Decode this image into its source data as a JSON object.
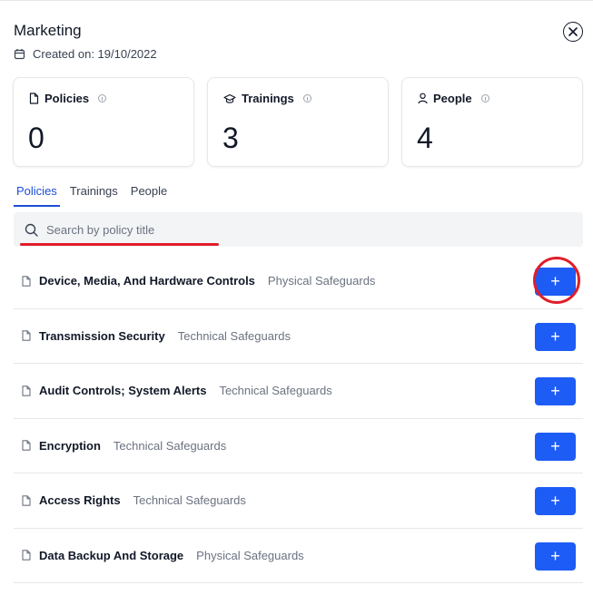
{
  "header": {
    "title": "Marketing",
    "created_label": "Created on: 19/10/2022"
  },
  "stats": [
    {
      "label": "Policies",
      "value": "0",
      "icon": "document-icon"
    },
    {
      "label": "Trainings",
      "value": "3",
      "icon": "graduation-cap-icon"
    },
    {
      "label": "People",
      "value": "4",
      "icon": "person-icon"
    }
  ],
  "tabs": [
    {
      "label": "Policies",
      "active": true
    },
    {
      "label": "Trainings",
      "active": false
    },
    {
      "label": "People",
      "active": false
    }
  ],
  "search": {
    "placeholder": "Search by policy title",
    "value": ""
  },
  "policies": [
    {
      "name": "Device, Media, And Hardware Controls",
      "category": "Physical Safeguards"
    },
    {
      "name": "Transmission Security",
      "category": "Technical Safeguards"
    },
    {
      "name": "Audit Controls; System Alerts",
      "category": "Technical Safeguards"
    },
    {
      "name": "Encryption",
      "category": "Technical Safeguards"
    },
    {
      "name": "Access Rights",
      "category": "Technical Safeguards"
    },
    {
      "name": "Data Backup And Storage",
      "category": "Physical Safeguards"
    }
  ],
  "add_button_label": "+",
  "colors": {
    "accent": "#1d5cf5",
    "annotation": "#e11d2a",
    "tab_active": "#1d4ed8"
  }
}
